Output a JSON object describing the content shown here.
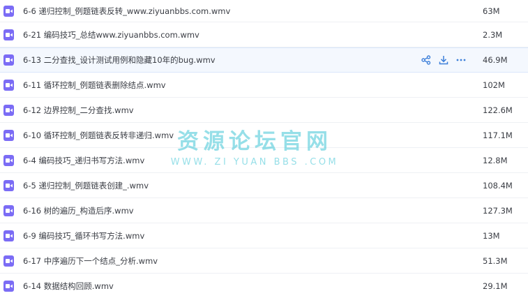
{
  "files": [
    {
      "name": "6-6 递归控制_例题链表反转_www.ziyuanbbs.com.wmv",
      "size": "63M"
    },
    {
      "name": "6-21 编码技巧_总结www.ziyuanbbs.com.wmv",
      "size": "2.3M"
    },
    {
      "name": "6-13 二分查找_设计测试用例和隐藏10年的bug.wmv",
      "size": "46.9M"
    },
    {
      "name": "6-11 循环控制_例题链表删除结点.wmv",
      "size": "102M"
    },
    {
      "name": "6-12 边界控制_二分查找.wmv",
      "size": "122.6M"
    },
    {
      "name": "6-10 循环控制_例题链表反转非递归.wmv",
      "size": "117.1M"
    },
    {
      "name": "6-4 编码技巧_递归书写方法.wmv",
      "size": "12.8M"
    },
    {
      "name": "6-5 递归控制_例题链表创建_.wmv",
      "size": "108.4M"
    },
    {
      "name": "6-16 树的遍历_构造后序.wmv",
      "size": "127.3M"
    },
    {
      "name": "6-9 编码技巧_循环书写方法.wmv",
      "size": "13M"
    },
    {
      "name": "6-17 中序遍历下一个结点_分析.wmv",
      "size": "51.3M"
    },
    {
      "name": "6-14 数据结构回顾.wmv",
      "size": "29.1M"
    }
  ],
  "row_actions": {
    "share_icon": "share-icon",
    "download_icon": "download-icon",
    "more_icon": "more-icon"
  },
  "watermark": {
    "title": "资源论坛官网",
    "subtitle": "WWW. ZI YUAN BBS .COM"
  },
  "colors": {
    "file_icon": "#7b6cf5",
    "action_icon": "#3d7fd9",
    "hover_row": "#f4f8fe",
    "watermark": "#40c4d6"
  }
}
